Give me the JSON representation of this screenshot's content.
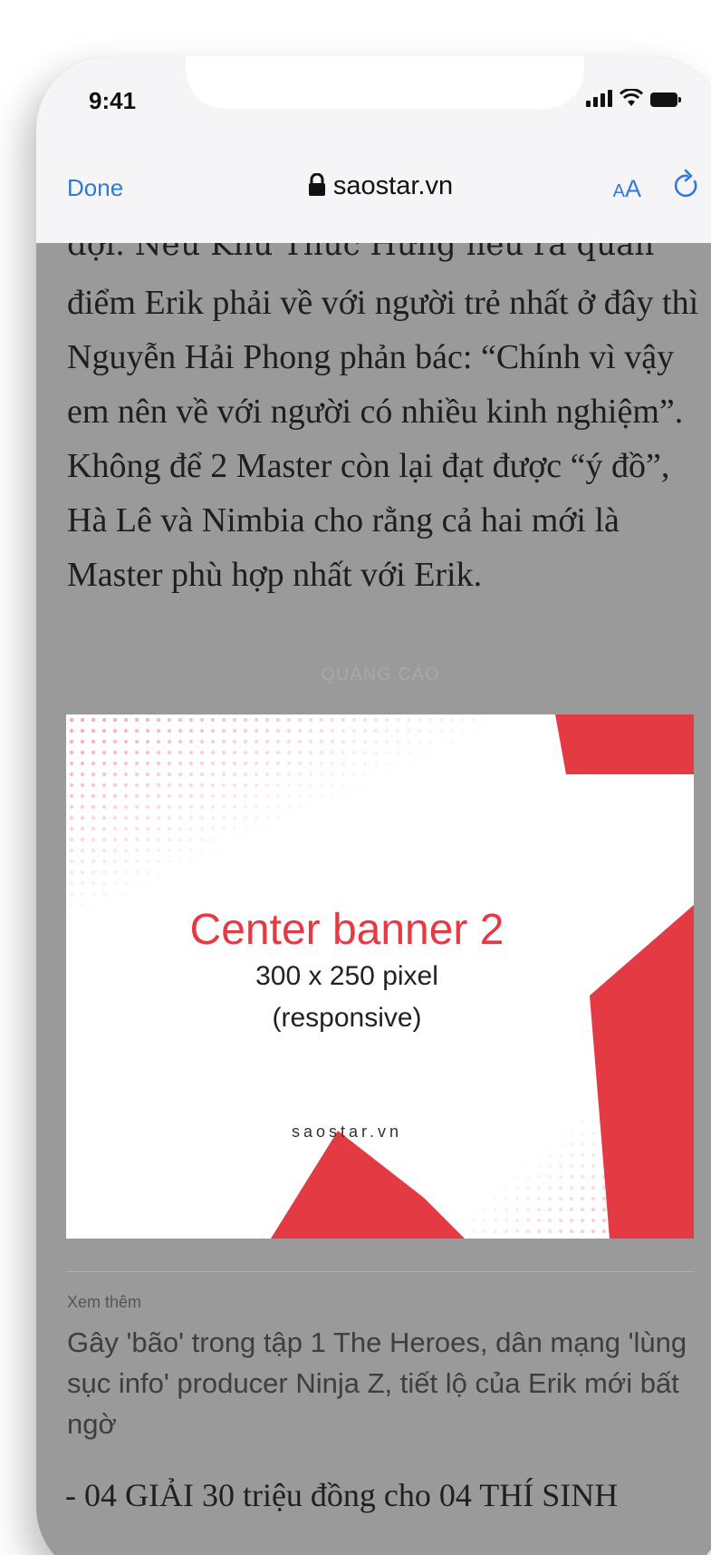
{
  "status_bar": {
    "time": "9:41"
  },
  "browser": {
    "done_label": "Done",
    "domain": "saostar.vn",
    "text_size_label_small": "A",
    "text_size_label_large": "A"
  },
  "article": {
    "cut_line": "đợi. Nếu Khu Thúc Hưng nêu ra quan",
    "paragraph": "điểm Erik phải về với người trẻ nhất ở đây thì Nguyễn Hải Phong phản bác: “Chính vì vậy em nên về với người có nhiều kinh nghiệm”. Không để 2 Master còn lại đạt được “ý đồ”, Hà Lê và Nimbia cho rằng cả hai mới là Master phù hợp nhất với Erik.",
    "ad_label": "QUẢNG CÁO",
    "ad": {
      "title": "Center banner 2",
      "size": "300 x 250 pixel",
      "note": "(responsive)",
      "brand": "saostar.vn",
      "accent_color": "#e43a44"
    },
    "see_more_label": "Xem thêm",
    "related_title": "Gây 'bão' trong tập 1 The Heroes, dân mạng 'lùng sục info' producer Ninja Z, tiết lộ của Erik mới bất ngờ",
    "bottom_line": "- 04 GIẢI 30 triệu đồng cho 04 THÍ SINH"
  }
}
